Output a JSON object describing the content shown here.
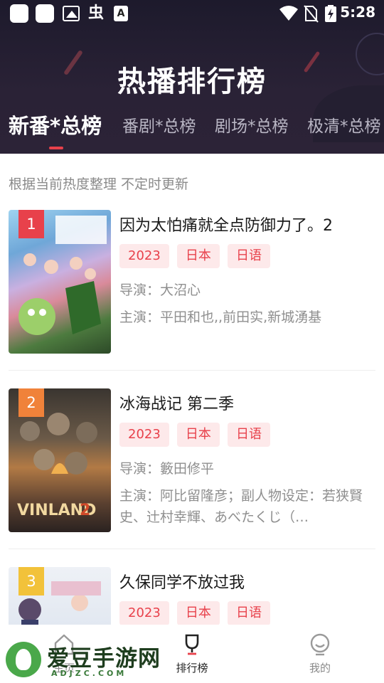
{
  "status_bar": {
    "time": "5:28",
    "left_icons": [
      "app-square-icon",
      "app-square-icon",
      "image-icon",
      "bug-icon",
      "text-a-icon"
    ],
    "right_icons": [
      "wifi-icon",
      "no-sim-icon",
      "battery-charging-icon"
    ],
    "bug_glyph": "虫",
    "a_glyph": "A"
  },
  "header": {
    "title": "热播排行榜",
    "tabs": [
      {
        "label": "新番*总榜",
        "active": true
      },
      {
        "label": "番剧*总榜",
        "active": false
      },
      {
        "label": "剧场*总榜",
        "active": false
      },
      {
        "label": "极清*总榜",
        "active": false
      }
    ]
  },
  "subtitle": "根据当前热度整理 不定时更新",
  "colors": {
    "accent": "#e8414b",
    "tag_bg": "#fde9ea",
    "rank1": "#e8414b",
    "rank2": "#f0823a",
    "rank3": "#f2c23a",
    "header_bg": "#231e30"
  },
  "items": [
    {
      "rank": "1",
      "title": "因为太怕痛就全点防御力了。2",
      "tags": [
        "2023",
        "日本",
        "日语"
      ],
      "director": "导演：大沼心",
      "cast": "主演：平田和也,,前田实,新城湧基"
    },
    {
      "rank": "2",
      "title": "冰海战记 第二季",
      "tags": [
        "2023",
        "日本",
        "日语"
      ],
      "director": "导演：籔田修平",
      "cast": "主演：阿比留隆彦；副人物设定：若狭賢史、辻村幸輝、あべたくじ（…"
    },
    {
      "rank": "3",
      "title": "久保同学不放过我",
      "tags": [
        "2023",
        "日本",
        "日语"
      ]
    }
  ],
  "bottom_nav": [
    {
      "label": "主页",
      "icon": "home-icon",
      "active": false
    },
    {
      "label": "排行榜",
      "icon": "trophy-icon",
      "active": true
    },
    {
      "label": "我的",
      "icon": "user-icon",
      "active": false
    }
  ],
  "watermark": {
    "text": "爱豆手游网",
    "sub": "ADJZC.COM"
  }
}
